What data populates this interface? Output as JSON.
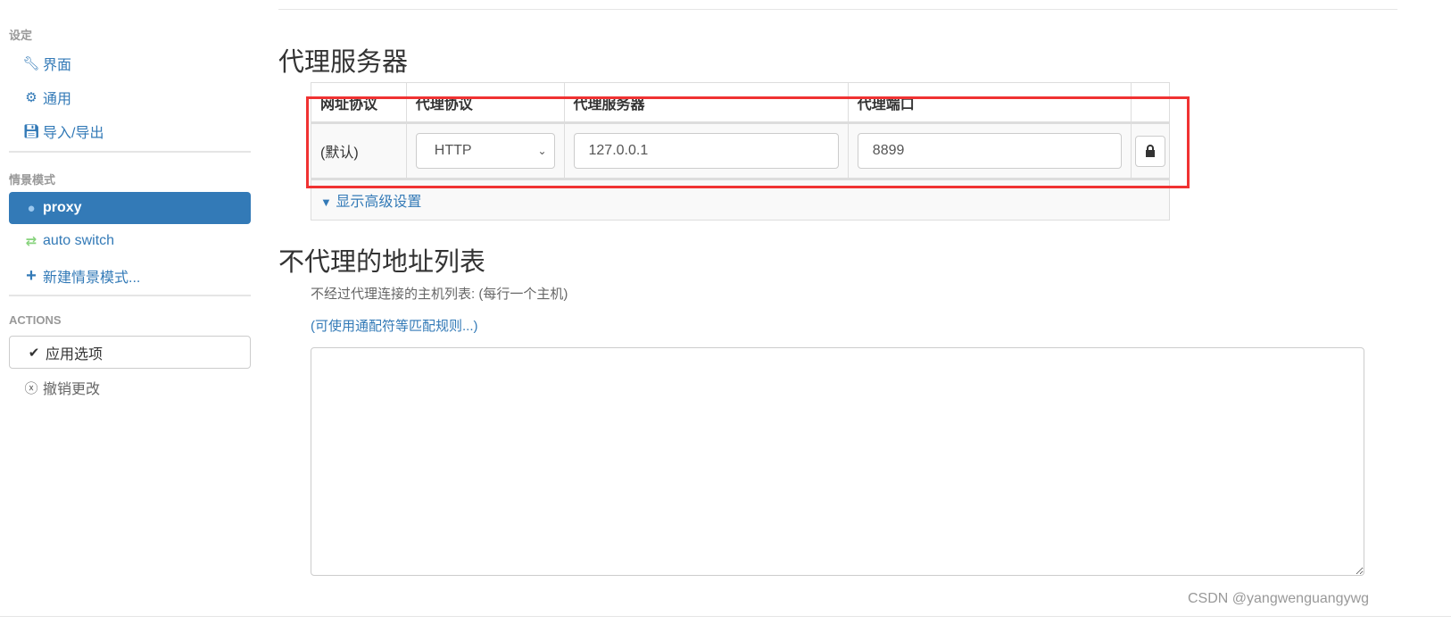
{
  "sidebar": {
    "settings_header": "设定",
    "settings_items": [
      {
        "label": "界面",
        "icon": "wrench-icon"
      },
      {
        "label": "通用",
        "icon": "gear-icon"
      },
      {
        "label": "导入/导出",
        "icon": "floppy-import-icon"
      }
    ],
    "profiles_header": "情景模式",
    "profiles": [
      {
        "label": "proxy",
        "icon": "globe-icon",
        "active": true
      },
      {
        "label": "auto switch",
        "icon": "retweet-icon"
      },
      {
        "label": "新建情景模式...",
        "icon": "plus-icon"
      }
    ],
    "actions_header": "ACTIONS",
    "apply_label": "应用选项",
    "discard_label": "撤销更改"
  },
  "main": {
    "proxy_title": "代理服务器",
    "table": {
      "headers": [
        "网址协议",
        "代理协议",
        "代理服务器",
        "代理端口",
        ""
      ],
      "row": {
        "scheme": "(默认)",
        "protocol": "HTTP",
        "server": "127.0.0.1",
        "port": "8899"
      },
      "advanced_label": "显示高级设置"
    },
    "bypass_title": "不代理的地址列表",
    "bypass_help": "不经过代理连接的主机列表: (每行一个主机)",
    "bypass_link": "(可使用通配符等匹配规则...)",
    "bypass_value": ""
  },
  "watermark": "CSDN @yangwenguangywg",
  "colors": {
    "accent": "#337ab7",
    "highlight": "#f03232",
    "auto_switch_icon": "#87d37c"
  }
}
